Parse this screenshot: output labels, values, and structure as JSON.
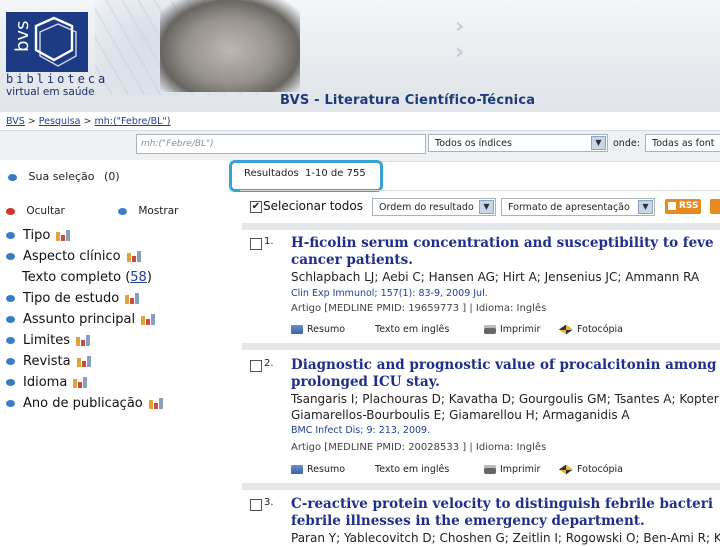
{
  "header": {
    "logo_mark": "bvs",
    "logo_line1": "biblioteca",
    "logo_line2": "virtual em saúde",
    "title": "BVS - Literatura Científico-Técnica"
  },
  "breadcrumb": {
    "items": [
      "BVS",
      "Pesquisa",
      "mh:(\"Febre/BL\")"
    ],
    "separator": ">"
  },
  "search": {
    "query_value": "mh:(\"Febre/BL\")",
    "index_selected": "Todos os índices",
    "where_label": "onde:",
    "source_selected": "Todas as font"
  },
  "sidebar": {
    "selection_label": "Sua seleção",
    "selection_count": "(0)",
    "hide_label": "Ocultar",
    "show_label": "Mostrar",
    "facets": [
      {
        "label": "Tipo",
        "has_chart": true
      },
      {
        "label": "Aspecto clínico",
        "has_chart": true
      },
      {
        "label": "Texto completo",
        "count": "58",
        "has_chart": false
      },
      {
        "label": "Tipo de estudo",
        "has_chart": true
      },
      {
        "label": "Assunto principal",
        "has_chart": true
      },
      {
        "label": "Limites",
        "has_chart": true
      },
      {
        "label": "Revista",
        "has_chart": true
      },
      {
        "label": "Idioma",
        "has_chart": true
      },
      {
        "label": "Ano de publicação",
        "has_chart": true
      }
    ]
  },
  "results_header": {
    "label": "Resultados  1-10 de 755",
    "select_all": "Selecionar todos",
    "order_selected": "Ordem do resultado",
    "format_selected": "Formato de apresentação",
    "rss_label": "RSS"
  },
  "results": [
    {
      "num": "1.",
      "title_line1": "H-ficolin serum concentration and susceptibility to feve",
      "title_line2": "cancer patients.",
      "authors_line1": "Schlapbach LJ; Aebi C; Hansen AG; Hirt A; Jensenius JC; Ammann RA",
      "authors_line2": "",
      "source": "Clin Exp Immunol; 157(1): 83-9, 2009 Jul.",
      "meta": "Artigo [MEDLINE PMID: 19659773 ] | Idioma: Inglês",
      "actions": [
        "Resumo",
        "Texto em inglês",
        "Imprimir",
        "Fotocópia"
      ]
    },
    {
      "num": "2.",
      "title_line1": "Diagnostic and prognostic value of procalcitonin among",
      "title_line2": "prolonged ICU stay.",
      "authors_line1": "Tsangaris I; Plachouras D; Kavatha D; Gourgoulis GM; Tsantes A; Kopter",
      "authors_line2": "Giamarellos-Bourboulis E; Giamarellou H; Armaganidis A",
      "source": "BMC Infect Dis; 9: 213, 2009.",
      "meta": "Artigo [MEDLINE PMID: 20028533 ] | Idioma: Inglês",
      "actions": [
        "Resumo",
        "Texto em inglês",
        "Imprimir",
        "Fotocópia"
      ]
    },
    {
      "num": "3.",
      "title_line1": "C-reactive protein velocity to distinguish febrile bacteri",
      "title_line2": "febrile illnesses in the emergency department.",
      "authors_line1": "Paran Y; Yablecovitch D; Choshen G; Zeitlin I; Rogowski O; Ben-Ami R; K",
      "authors_line2": "",
      "source": "",
      "meta": "",
      "actions": []
    }
  ],
  "colors": {
    "link_blue": "#1f3f9a",
    "title_blue": "#1f2e8a",
    "highlight_border": "#3aa0d8",
    "logo_navy": "#1d3a84",
    "rss_orange": "#e58a1f"
  }
}
